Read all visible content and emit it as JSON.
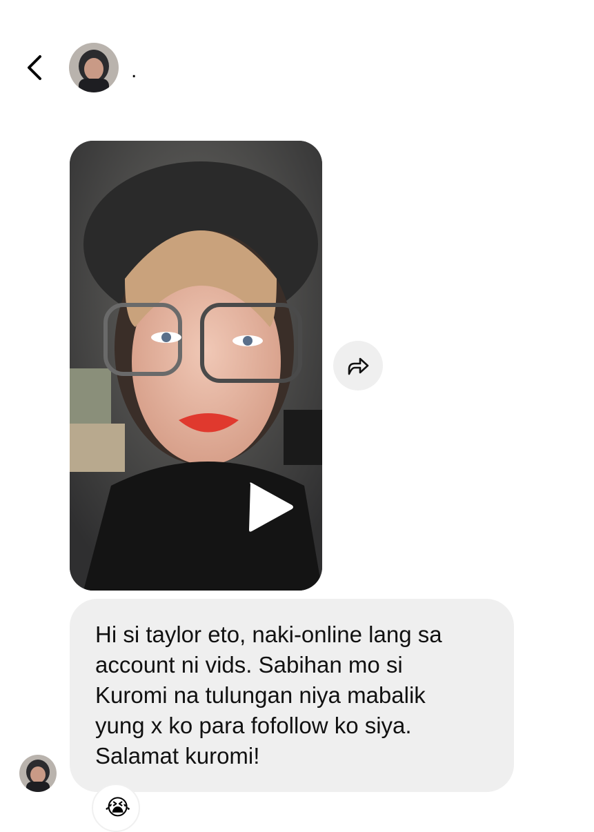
{
  "header": {
    "back_icon": "chevron-left-icon",
    "contact_name": "."
  },
  "message_video": {
    "type": "video",
    "play_icon": "play-icon"
  },
  "share_button": {
    "icon": "share-arrow-icon"
  },
  "message_text": {
    "text": "Hi si taylor eto, naki-online lang sa\naccount ni vids. Sabihan mo si\nKuromi na tulungan niya mabalik\nyung x ko para fofollow ko siya.\nSalamat kuromi!"
  },
  "reaction": {
    "emoji": "😭"
  },
  "colors": {
    "bubble_background": "#efefef",
    "text": "#111111",
    "background": "#ffffff"
  }
}
